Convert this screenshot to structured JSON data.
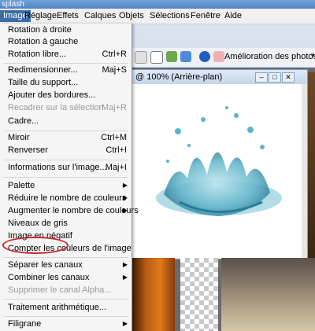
{
  "window": {
    "title_fragment": "splash"
  },
  "menubar": [
    {
      "label": "Image",
      "active": true
    },
    {
      "label": "Réglage"
    },
    {
      "label": "Effets"
    },
    {
      "label": "Calques"
    },
    {
      "label": "Objets"
    },
    {
      "label": "Sélections"
    },
    {
      "label": "Fenêtre"
    },
    {
      "label": "Aide"
    }
  ],
  "toolbar": {
    "enhance_label": "Amélioration des photos"
  },
  "document": {
    "title": "@ 100% (Arrière-plan)"
  },
  "menu": {
    "rotate_right": "Rotation à droite",
    "rotate_left": "Rotation à gauche",
    "free_rotate": "Rotation libre...",
    "free_rotate_sc": "Ctrl+R",
    "resize": "Redimensionner...",
    "resize_sc": "Maj+S",
    "canvas_size": "Taille du support...",
    "add_borders": "Ajouter des bordures...",
    "crop_selection": "Recadrer sur la sélection",
    "crop_selection_sc": "Maj+R",
    "frame": "Cadre...",
    "mirror": "Miroir",
    "mirror_sc": "Ctrl+M",
    "flip": "Renverser",
    "flip_sc": "Ctrl+I",
    "image_info": "Informations sur l'image...",
    "image_info_sc": "Maj+I",
    "palette": "Palette",
    "reduce_colors": "Réduire le nombre de couleurs",
    "increase_colors": "Augmenter le nombre de couleurs",
    "greyscale": "Niveaux de gris",
    "negative": "Image en négatif",
    "count_colors": "Compter les couleurs de l'image",
    "split_channels": "Séparer les canaux",
    "combine_channels": "Combiner les canaux",
    "delete_alpha": "Supprimer le canal Alpha...",
    "arithmetic": "Traitement arithmétique...",
    "watermark": "Filigrane"
  },
  "colors": {
    "highlight_circle": "#d0202a",
    "menu_active": "#3a6ea5"
  }
}
